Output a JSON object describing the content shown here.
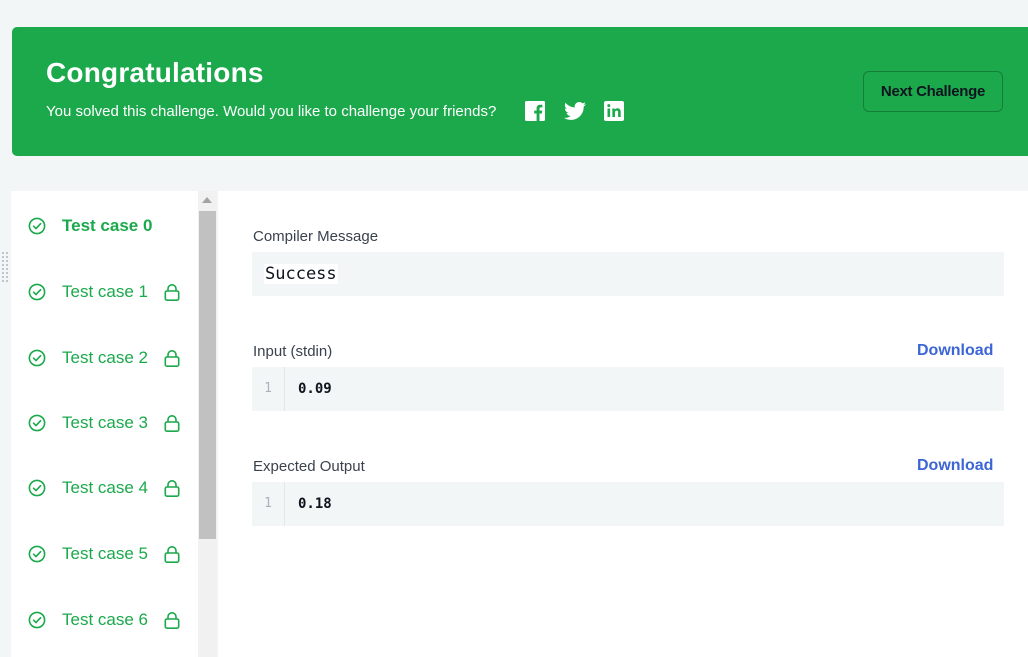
{
  "banner": {
    "title": "Congratulations",
    "subtitle": "You solved this challenge. Would you like to challenge your friends?",
    "social": [
      "facebook-icon",
      "twitter-icon",
      "linkedin-icon"
    ],
    "next_label": "Next Challenge",
    "color": "#1ba94c"
  },
  "test_cases": [
    {
      "label": "Test case 0",
      "status": "passed",
      "locked": false,
      "active": true
    },
    {
      "label": "Test case 1",
      "status": "passed",
      "locked": true,
      "active": false
    },
    {
      "label": "Test case 2",
      "status": "passed",
      "locked": true,
      "active": false
    },
    {
      "label": "Test case 3",
      "status": "passed",
      "locked": true,
      "active": false
    },
    {
      "label": "Test case 4",
      "status": "passed",
      "locked": true,
      "active": false
    },
    {
      "label": "Test case 5",
      "status": "passed",
      "locked": true,
      "active": false
    },
    {
      "label": "Test case 6",
      "status": "passed",
      "locked": true,
      "active": false
    }
  ],
  "compiler": {
    "label": "Compiler Message",
    "message": "Success"
  },
  "input": {
    "label": "Input (stdin)",
    "download_label": "Download",
    "line_number": "1",
    "value": "0.09"
  },
  "expected": {
    "label": "Expected Output",
    "download_label": "Download",
    "line_number": "1",
    "value": "0.18"
  },
  "colors": {
    "success": "#1ba94c",
    "link": "#3c65d6",
    "text": "#39424e"
  }
}
